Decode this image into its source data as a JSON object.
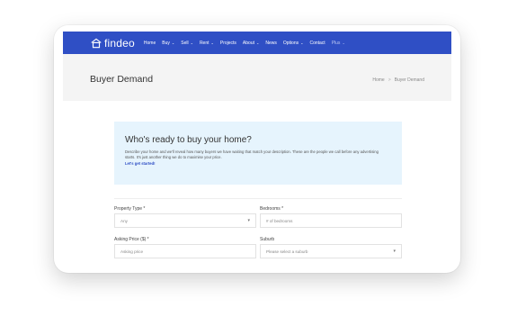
{
  "brand": {
    "name": "findeo"
  },
  "nav": {
    "items": [
      {
        "label": "Home",
        "caret": false
      },
      {
        "label": "Buy",
        "caret": true
      },
      {
        "label": "Sell",
        "caret": true
      },
      {
        "label": "Rent",
        "caret": true
      },
      {
        "label": "Projects",
        "caret": false
      },
      {
        "label": "About",
        "caret": true
      },
      {
        "label": "News",
        "caret": false
      },
      {
        "label": "Options",
        "caret": true
      },
      {
        "label": "Contact",
        "caret": false
      },
      {
        "label": "Plus",
        "caret": true
      }
    ]
  },
  "page": {
    "title": "Buyer Demand",
    "breadcrumb": {
      "home": "Home",
      "separator": ">",
      "current": "Buyer Demand"
    }
  },
  "hero": {
    "title": "Who's ready to buy your home?",
    "description": "Describe your home and we'll reveal how many buyers we have waiting that match your description. These are the people we call before any advertising starts. It's just another thing we do to maximise your price.",
    "cta": "Let's get started!"
  },
  "form": {
    "property_type": {
      "label": "Property Type *",
      "value": "Any"
    },
    "bedrooms": {
      "label": "Bedrooms *",
      "placeholder": "# of bedrooms"
    },
    "asking_price": {
      "label": "Asking Price ($) *",
      "placeholder": "Asking price"
    },
    "suburb": {
      "label": "Suburb",
      "placeholder": "Please select a suburb"
    }
  },
  "colors": {
    "primary": "#2f4fc5",
    "hero_bg": "#e6f4fd",
    "titlebar_bg": "#f4f4f4"
  }
}
